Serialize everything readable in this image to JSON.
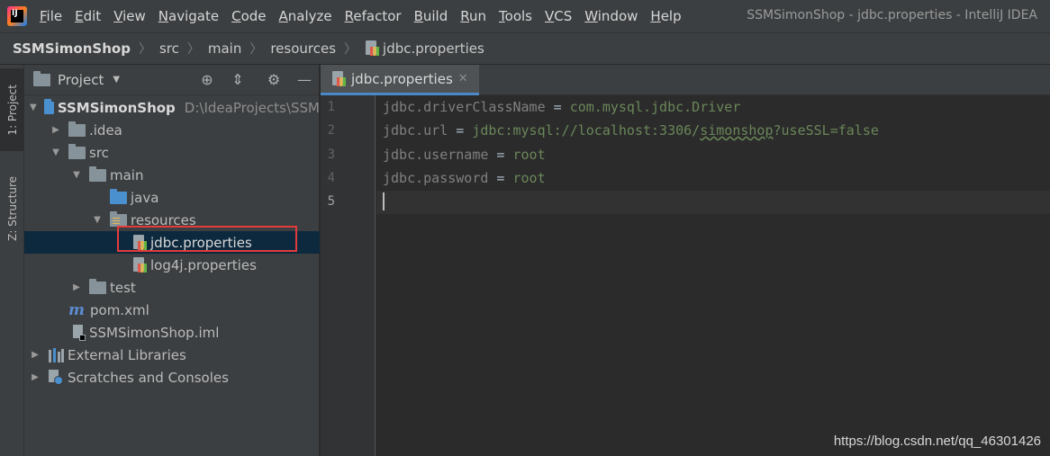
{
  "menubar": {
    "items": [
      "File",
      "Edit",
      "View",
      "Navigate",
      "Code",
      "Analyze",
      "Refactor",
      "Build",
      "Run",
      "Tools",
      "VCS",
      "Window",
      "Help"
    ],
    "window_title": "SSMSimonShop - jdbc.properties - IntelliJ IDEA"
  },
  "breadcrumb": [
    "SSMSimonShop",
    "src",
    "main",
    "resources",
    "jdbc.properties"
  ],
  "stripe": {
    "project_tab": "1: Project",
    "structure_tab": "Z: Structure"
  },
  "project_panel": {
    "title": "Project",
    "tree": {
      "root": "SSMSimonShop",
      "root_path": "D:\\IdeaProjects\\SSM",
      "idea": ".idea",
      "src": "src",
      "main": "main",
      "java": "java",
      "resources": "resources",
      "jdbc": "jdbc.properties",
      "log4j": "log4j.properties",
      "test": "test",
      "pom": "pom.xml",
      "iml": "SSMSimonShop.iml",
      "external_libs": "External Libraries",
      "scratches": "Scratches and Consoles"
    }
  },
  "editor": {
    "tab_label": "jdbc.properties",
    "line_numbers": [
      "1",
      "2",
      "3",
      "4",
      "5"
    ],
    "lines": [
      {
        "key": "jdbc.driverClassName",
        "sep": " = ",
        "value": "com.mysql.jdbc.Driver"
      },
      {
        "key": "jdbc.url",
        "sep": " = ",
        "value_pre": "jdbc:mysql://localhost:3306/",
        "value_under": "simonshop",
        "value_post": "?useSSL=false"
      },
      {
        "key": "jdbc.username",
        "sep": " = ",
        "value": "root"
      },
      {
        "key": "jdbc.password",
        "sep": " = ",
        "value": "root"
      }
    ]
  },
  "watermark": "https://blog.csdn.net/qq_46301426",
  "colors": {
    "key": "#808080",
    "value": "#6a8759",
    "selection": "#0d293e",
    "highlight_box": "#e33b3b"
  }
}
